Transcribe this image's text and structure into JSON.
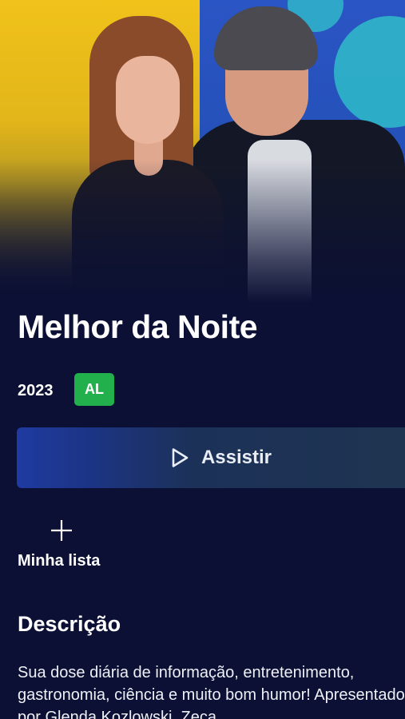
{
  "show": {
    "title": "Melhor da Noite",
    "year": "2023",
    "rating": "AL",
    "rating_color": "#22b04c"
  },
  "actions": {
    "play_label": "Assistir",
    "play_icon": "play-icon",
    "mylist_label": "Minha lista",
    "mylist_icon": "plus-icon"
  },
  "description": {
    "heading": "Descrição",
    "text": "Sua dose diária de informação, entretenimento, gastronomia, ciência e muito bom humor! Apresentado por Glenda Kozlowski, Zeca"
  },
  "colors": {
    "background": "#0b1034",
    "accent_blue": "#1f3aa1",
    "hero_yellow": "#f1c21a"
  }
}
